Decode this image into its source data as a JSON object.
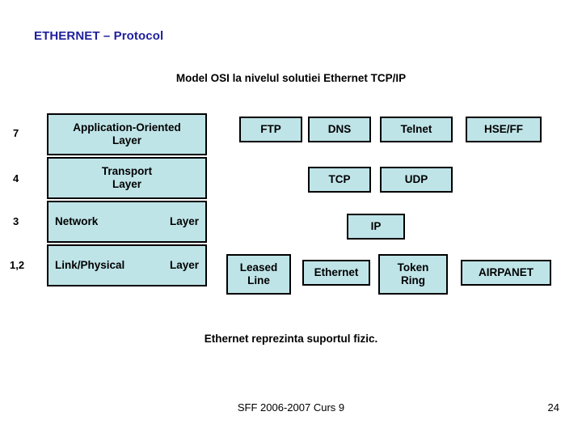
{
  "slide": {
    "title": "ETHERNET – Protocol",
    "subtitle": "Model OSI la nivelul solutiei Ethernet TCP/IP",
    "footnote": "Ethernet reprezinta suportul fizic.",
    "footer_center": "SFF 2006-2007 Curs 9",
    "footer_page": "24"
  },
  "layer_numbers": {
    "application": "7",
    "transport": "4",
    "network": "3",
    "link_physical": "1,2"
  },
  "stack": {
    "application": {
      "line1": "Application-Oriented",
      "line2": "Layer"
    },
    "transport": {
      "line1": "Transport",
      "line2": "Layer"
    },
    "network": {
      "left": "Network",
      "right": "Layer"
    },
    "link_physical": {
      "left": "Link/Physical",
      "right": "Layer"
    }
  },
  "protocols": {
    "application_row": [
      {
        "label": "FTP"
      },
      {
        "label": "DNS"
      },
      {
        "label": "Telnet"
      },
      {
        "label": "HSE/FF"
      }
    ],
    "transport_row": [
      {
        "label": "TCP"
      },
      {
        "label": "UDP"
      }
    ],
    "network_row": [
      {
        "label": "IP"
      }
    ],
    "link_row": [
      {
        "line1": "Leased",
        "line2": "Line"
      },
      {
        "line1": "Ethernet",
        "line2": ""
      },
      {
        "line1": "Token",
        "line2": "Ring"
      },
      {
        "line1": "AIRPANET",
        "line2": ""
      }
    ]
  },
  "colors": {
    "box_fill": "#bfe4e8",
    "box_border": "#000000",
    "title_color": "#1f1f9c"
  }
}
